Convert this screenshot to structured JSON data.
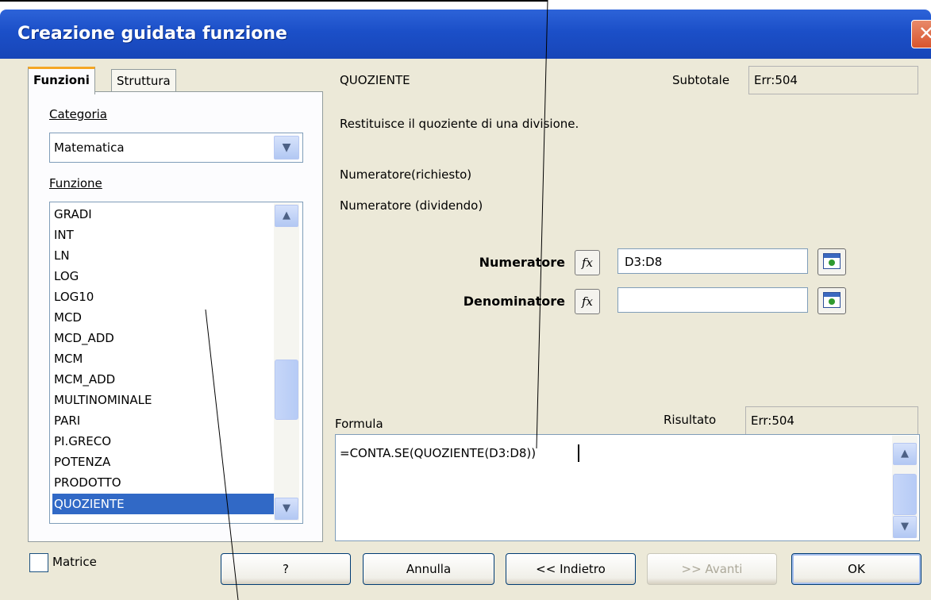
{
  "window": {
    "title": "Creazione guidata funzione",
    "close_glyph": "✕"
  },
  "tabs": [
    {
      "label": "Funzioni",
      "active": true
    },
    {
      "label": "Struttura",
      "active": false
    }
  ],
  "left_panel": {
    "category_label": "Categoria",
    "category_value": "Matematica",
    "function_label": "Funzione",
    "functions": [
      "GRADI",
      "INT",
      "LN",
      "LOG",
      "LOG10",
      "MCD",
      "MCD_ADD",
      "MCM",
      "MCM_ADD",
      "MULTINOMINALE",
      "PARI",
      "PI.GRECO",
      "POTENZA",
      "PRODOTTO",
      "QUOZIENTE"
    ],
    "selected_function": "QUOZIENTE"
  },
  "right_panel": {
    "function_name": "QUOZIENTE",
    "subtotal_label": "Subtotale",
    "subtotal_value": "Err:504",
    "description": "Restituisce il quoziente di una divisione.",
    "arg_required": "Numeratore(richiesto)",
    "arg_description": "Numeratore (dividendo)",
    "arguments": [
      {
        "label": "Numeratore",
        "value": "D3:D8"
      },
      {
        "label": "Denominatore",
        "value": ""
      }
    ],
    "fx_label": "fx",
    "formula_label": "Formula",
    "result_label": "Risultato",
    "result_value": "Err:504",
    "formula_text": "=CONTA.SE(QUOZIENTE(D3:D8))"
  },
  "footer": {
    "matrix_label": "Matrice",
    "help_label": "?",
    "cancel_label": "Annulla",
    "back_label": "<< Indietro",
    "next_label": ">> Avanti",
    "ok_label": "OK"
  },
  "colors": {
    "title_bar": "#1b4fc8",
    "dialog_bg": "#ece9d8",
    "selection": "#3169c6",
    "tab_accent": "#f5a623"
  },
  "icons": {
    "dropdown": "chevron-down-icon",
    "scroll_up": "chevron-up-icon",
    "scroll_down": "chevron-down-icon",
    "shrink": "shrink-dialog-icon"
  }
}
